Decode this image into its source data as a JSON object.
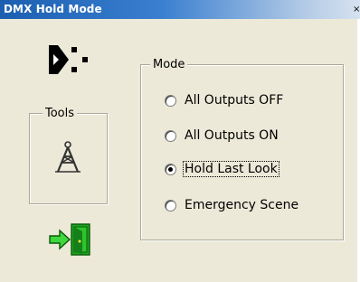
{
  "window": {
    "title": "DMX Hold Mode",
    "close_glyph": "×"
  },
  "tools_group": {
    "label": "Tools"
  },
  "mode_group": {
    "label": "Mode",
    "options": [
      {
        "label": "All Outputs OFF",
        "checked": false
      },
      {
        "label": "All Outputs ON",
        "checked": false
      },
      {
        "label": "Hold Last Look",
        "checked": true
      },
      {
        "label": "Emergency Scene",
        "checked": false
      }
    ],
    "selected": "Hold Last Look"
  },
  "icons": {
    "app": "dmx-logo-icon",
    "tool": "light-tower-icon",
    "exit": "exit-door-icon"
  },
  "colors": {
    "titlebar_start": "#1c5fb0",
    "window_bg": "#ece9d8",
    "exit_green": "#1ea51e"
  }
}
